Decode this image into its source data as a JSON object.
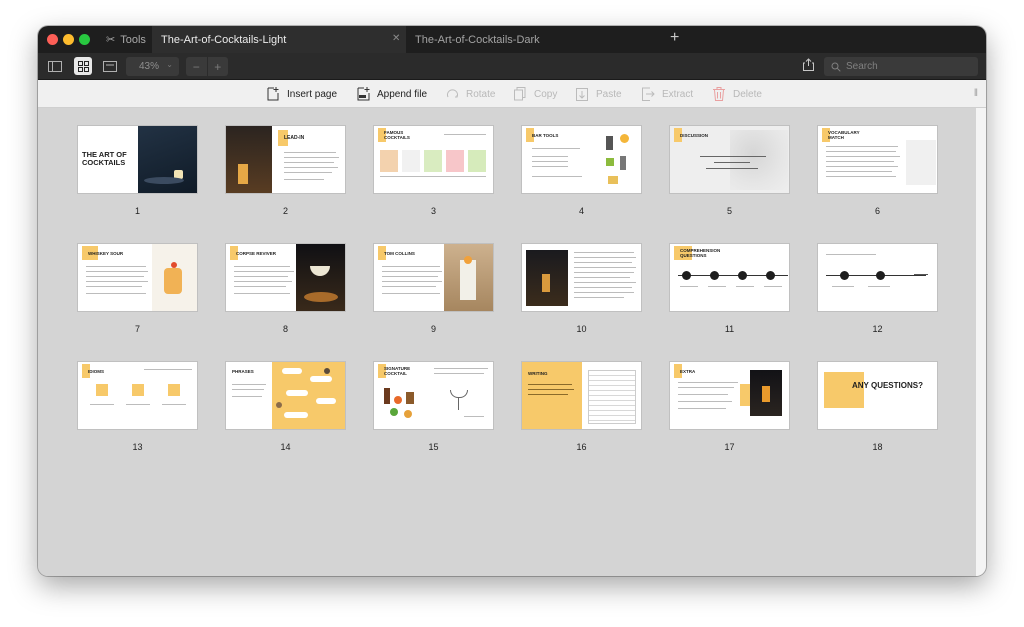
{
  "tabbar": {
    "tools_label": "Tools",
    "tabs": [
      {
        "label": "The-Art-of-Cocktails-Light",
        "active": true
      },
      {
        "label": "The-Art-of-Cocktails-Dark",
        "active": false
      }
    ]
  },
  "toolbar": {
    "zoom": "43%",
    "search_placeholder": "Search"
  },
  "actions": [
    {
      "label": "Insert page",
      "icon": "insert-page-icon",
      "enabled": true
    },
    {
      "label": "Append file",
      "icon": "append-file-icon",
      "enabled": true
    },
    {
      "label": "Rotate",
      "icon": "rotate-icon",
      "enabled": false
    },
    {
      "label": "Copy",
      "icon": "copy-icon",
      "enabled": false
    },
    {
      "label": "Paste",
      "icon": "paste-icon",
      "enabled": false
    },
    {
      "label": "Extract",
      "icon": "extract-icon",
      "enabled": false
    },
    {
      "label": "Delete",
      "icon": "delete-icon",
      "enabled": false
    }
  ],
  "pages": [
    {
      "num": "1",
      "title": "THE ART OF COCKTAILS"
    },
    {
      "num": "2",
      "title": "LEAD-IN"
    },
    {
      "num": "3",
      "title": "FAMOUS COCKTAILS"
    },
    {
      "num": "4",
      "title": "BAR TOOLS"
    },
    {
      "num": "5",
      "title": "DISCUSSION"
    },
    {
      "num": "6",
      "title": "VOCABULARY MATCH"
    },
    {
      "num": "7",
      "title": "WHISKEY SOUR"
    },
    {
      "num": "8",
      "title": "CORPSE REVIVER"
    },
    {
      "num": "9",
      "title": "TOM COLLINS"
    },
    {
      "num": "10",
      "title": ""
    },
    {
      "num": "11",
      "title": "COMPREHENSION QUESTIONS"
    },
    {
      "num": "12",
      "title": ""
    },
    {
      "num": "13",
      "title": "IDIOMS"
    },
    {
      "num": "14",
      "title": "PHRASES"
    },
    {
      "num": "15",
      "title": "SIGNATURE COCKTAIL"
    },
    {
      "num": "16",
      "title": "WRITING"
    },
    {
      "num": "17",
      "title": "EXTRA"
    },
    {
      "num": "18",
      "title": "ANY QUESTIONS?"
    }
  ],
  "colors": {
    "accent_yellow": "#f7c96a",
    "dark": "#1c1c22",
    "tab_bar": "#1e1e1e",
    "toolbar": "#2b2b2b"
  }
}
